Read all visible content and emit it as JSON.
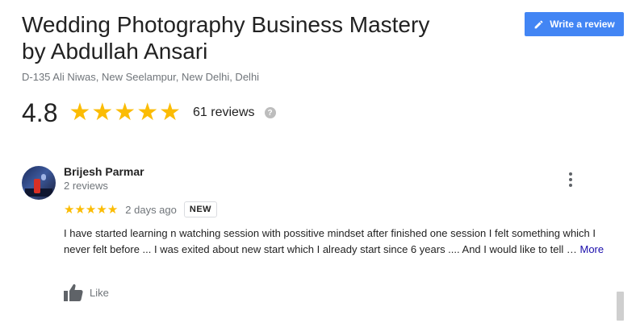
{
  "business": {
    "title": "Wedding Photography Business Mastery by Abdullah Ansari",
    "address": "D-135 Ali Niwas, New Seelampur, New Delhi, Delhi"
  },
  "rating": {
    "value": "4.8",
    "stars": 5,
    "review_count": "61 reviews",
    "help_icon": "question-circle-icon"
  },
  "write_review": {
    "label": "Write a review",
    "icon": "pencil-icon"
  },
  "review": {
    "author": "Brijesh Parmar",
    "author_reviews": "2 reviews",
    "stars": 5,
    "time": "2 days ago",
    "badge": "NEW",
    "text": "I have started learning n watching session with possitive mindset  after finished one session I felt something which I never felt before ... I was exited about new start which I already start since 6 years .... And I would like to tell …",
    "more_label": "More",
    "like_label": "Like",
    "more_icon": "more-vert-icon",
    "like_icon": "thumbs-up-icon"
  },
  "colors": {
    "star": "#fbbc04",
    "button": "#4285f4",
    "link": "#1a0dab"
  }
}
